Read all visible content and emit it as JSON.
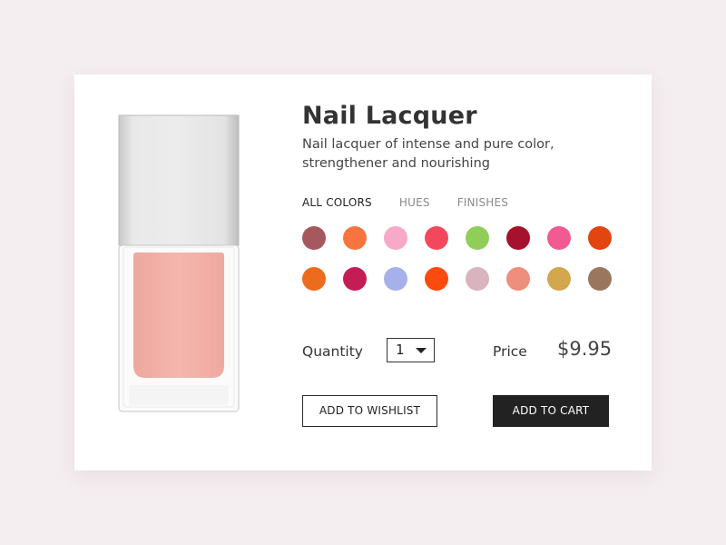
{
  "product": {
    "title": "Nail Lacquer",
    "description": "Nail lacquer of intense and pure color, strengthener and nourishing"
  },
  "tabs": [
    {
      "label": "ALL COLORS",
      "active": true
    },
    {
      "label": "HUES",
      "active": false
    },
    {
      "label": "FINISHES",
      "active": false
    }
  ],
  "swatches": [
    "#a6585f",
    "#f8743f",
    "#f6a9c8",
    "#f3485c",
    "#8fce59",
    "#a6112d",
    "#f25a92",
    "#e24610",
    "#ed6b1d",
    "#c41d55",
    "#a6b0ea",
    "#fd4a0e",
    "#d9b4bf",
    "#ee8e7c",
    "#d2a74e",
    "#9a765f"
  ],
  "purchase": {
    "quantity_label": "Quantity",
    "quantity_value": "1",
    "price_label": "Price",
    "price_value": "$9.95"
  },
  "buttons": {
    "wishlist": "ADD TO WISHLIST",
    "cart": "ADD TO CART"
  },
  "colors": {
    "polish": "#f4b2aa",
    "cap": "#e6e6e6",
    "primary_button": "#222222",
    "background": "#f4eef0"
  }
}
